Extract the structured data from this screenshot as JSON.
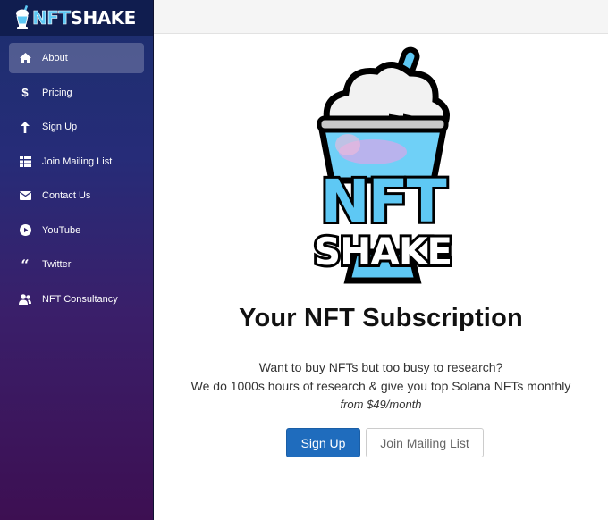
{
  "brand": {
    "name_part1": "NFT",
    "name_part2": "SHAKE",
    "logo_icon": "milkshake-icon"
  },
  "sidebar": {
    "items": [
      {
        "label": "About",
        "icon": "home-icon",
        "active": true
      },
      {
        "label": "Pricing",
        "icon": "dollar-icon",
        "active": false
      },
      {
        "label": "Sign Up",
        "icon": "arrow-up-icon",
        "active": false
      },
      {
        "label": "Join Mailing List",
        "icon": "list-icon",
        "active": false
      },
      {
        "label": "Contact Us",
        "icon": "envelope-icon",
        "active": false
      },
      {
        "label": "YouTube",
        "icon": "play-circle-icon",
        "active": false
      },
      {
        "label": "Twitter",
        "icon": "quote-icon",
        "active": false
      },
      {
        "label": "NFT Consultancy",
        "icon": "users-icon",
        "active": false
      }
    ]
  },
  "main": {
    "logo": {
      "line1": "NFT",
      "line2": "SHAKE"
    },
    "headline": "Your NFT Subscription",
    "tagline_line1": "Want to buy NFTs but too busy to research?",
    "tagline_line2": "We do 1000s hours of research & give you top Solana NFTs monthly",
    "price": "from $49/month",
    "primary_button": "Sign Up",
    "secondary_button": "Join Mailing List"
  },
  "colors": {
    "accent": "#1f6cbd",
    "brand_blue": "#5ec8f4",
    "sidebar_top": "#1c2f6e",
    "sidebar_bottom": "#3d0f52"
  }
}
